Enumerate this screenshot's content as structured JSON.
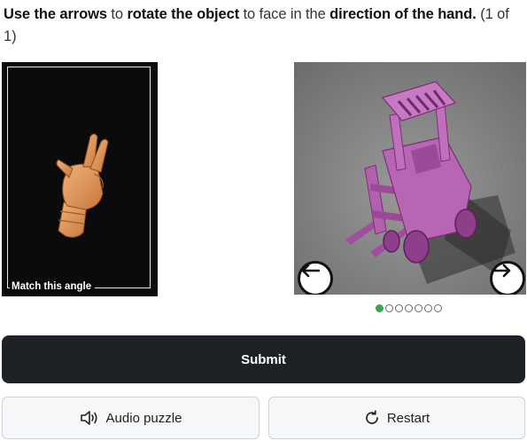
{
  "instruction": {
    "p1": "Use the arrows",
    "p2": " to ",
    "p3": "rotate the object",
    "p4": " to face in the ",
    "p5": "direction of the hand.",
    "p6": " (1 of 1)"
  },
  "reference": {
    "caption": "Match this angle",
    "icon": "hand-pointing-icon"
  },
  "object_view": {
    "icon": "forklift-model",
    "prev_icon": "arrow-left-icon",
    "next_icon": "arrow-right-icon"
  },
  "pagination": {
    "total": 7,
    "active_index": 0
  },
  "submit_label": "Submit",
  "audio_label": "Audio puzzle",
  "restart_label": "Restart",
  "colors": {
    "submit_bg": "#1e2226",
    "active_dot": "#3aa64d",
    "object_color": "#b25fae"
  }
}
